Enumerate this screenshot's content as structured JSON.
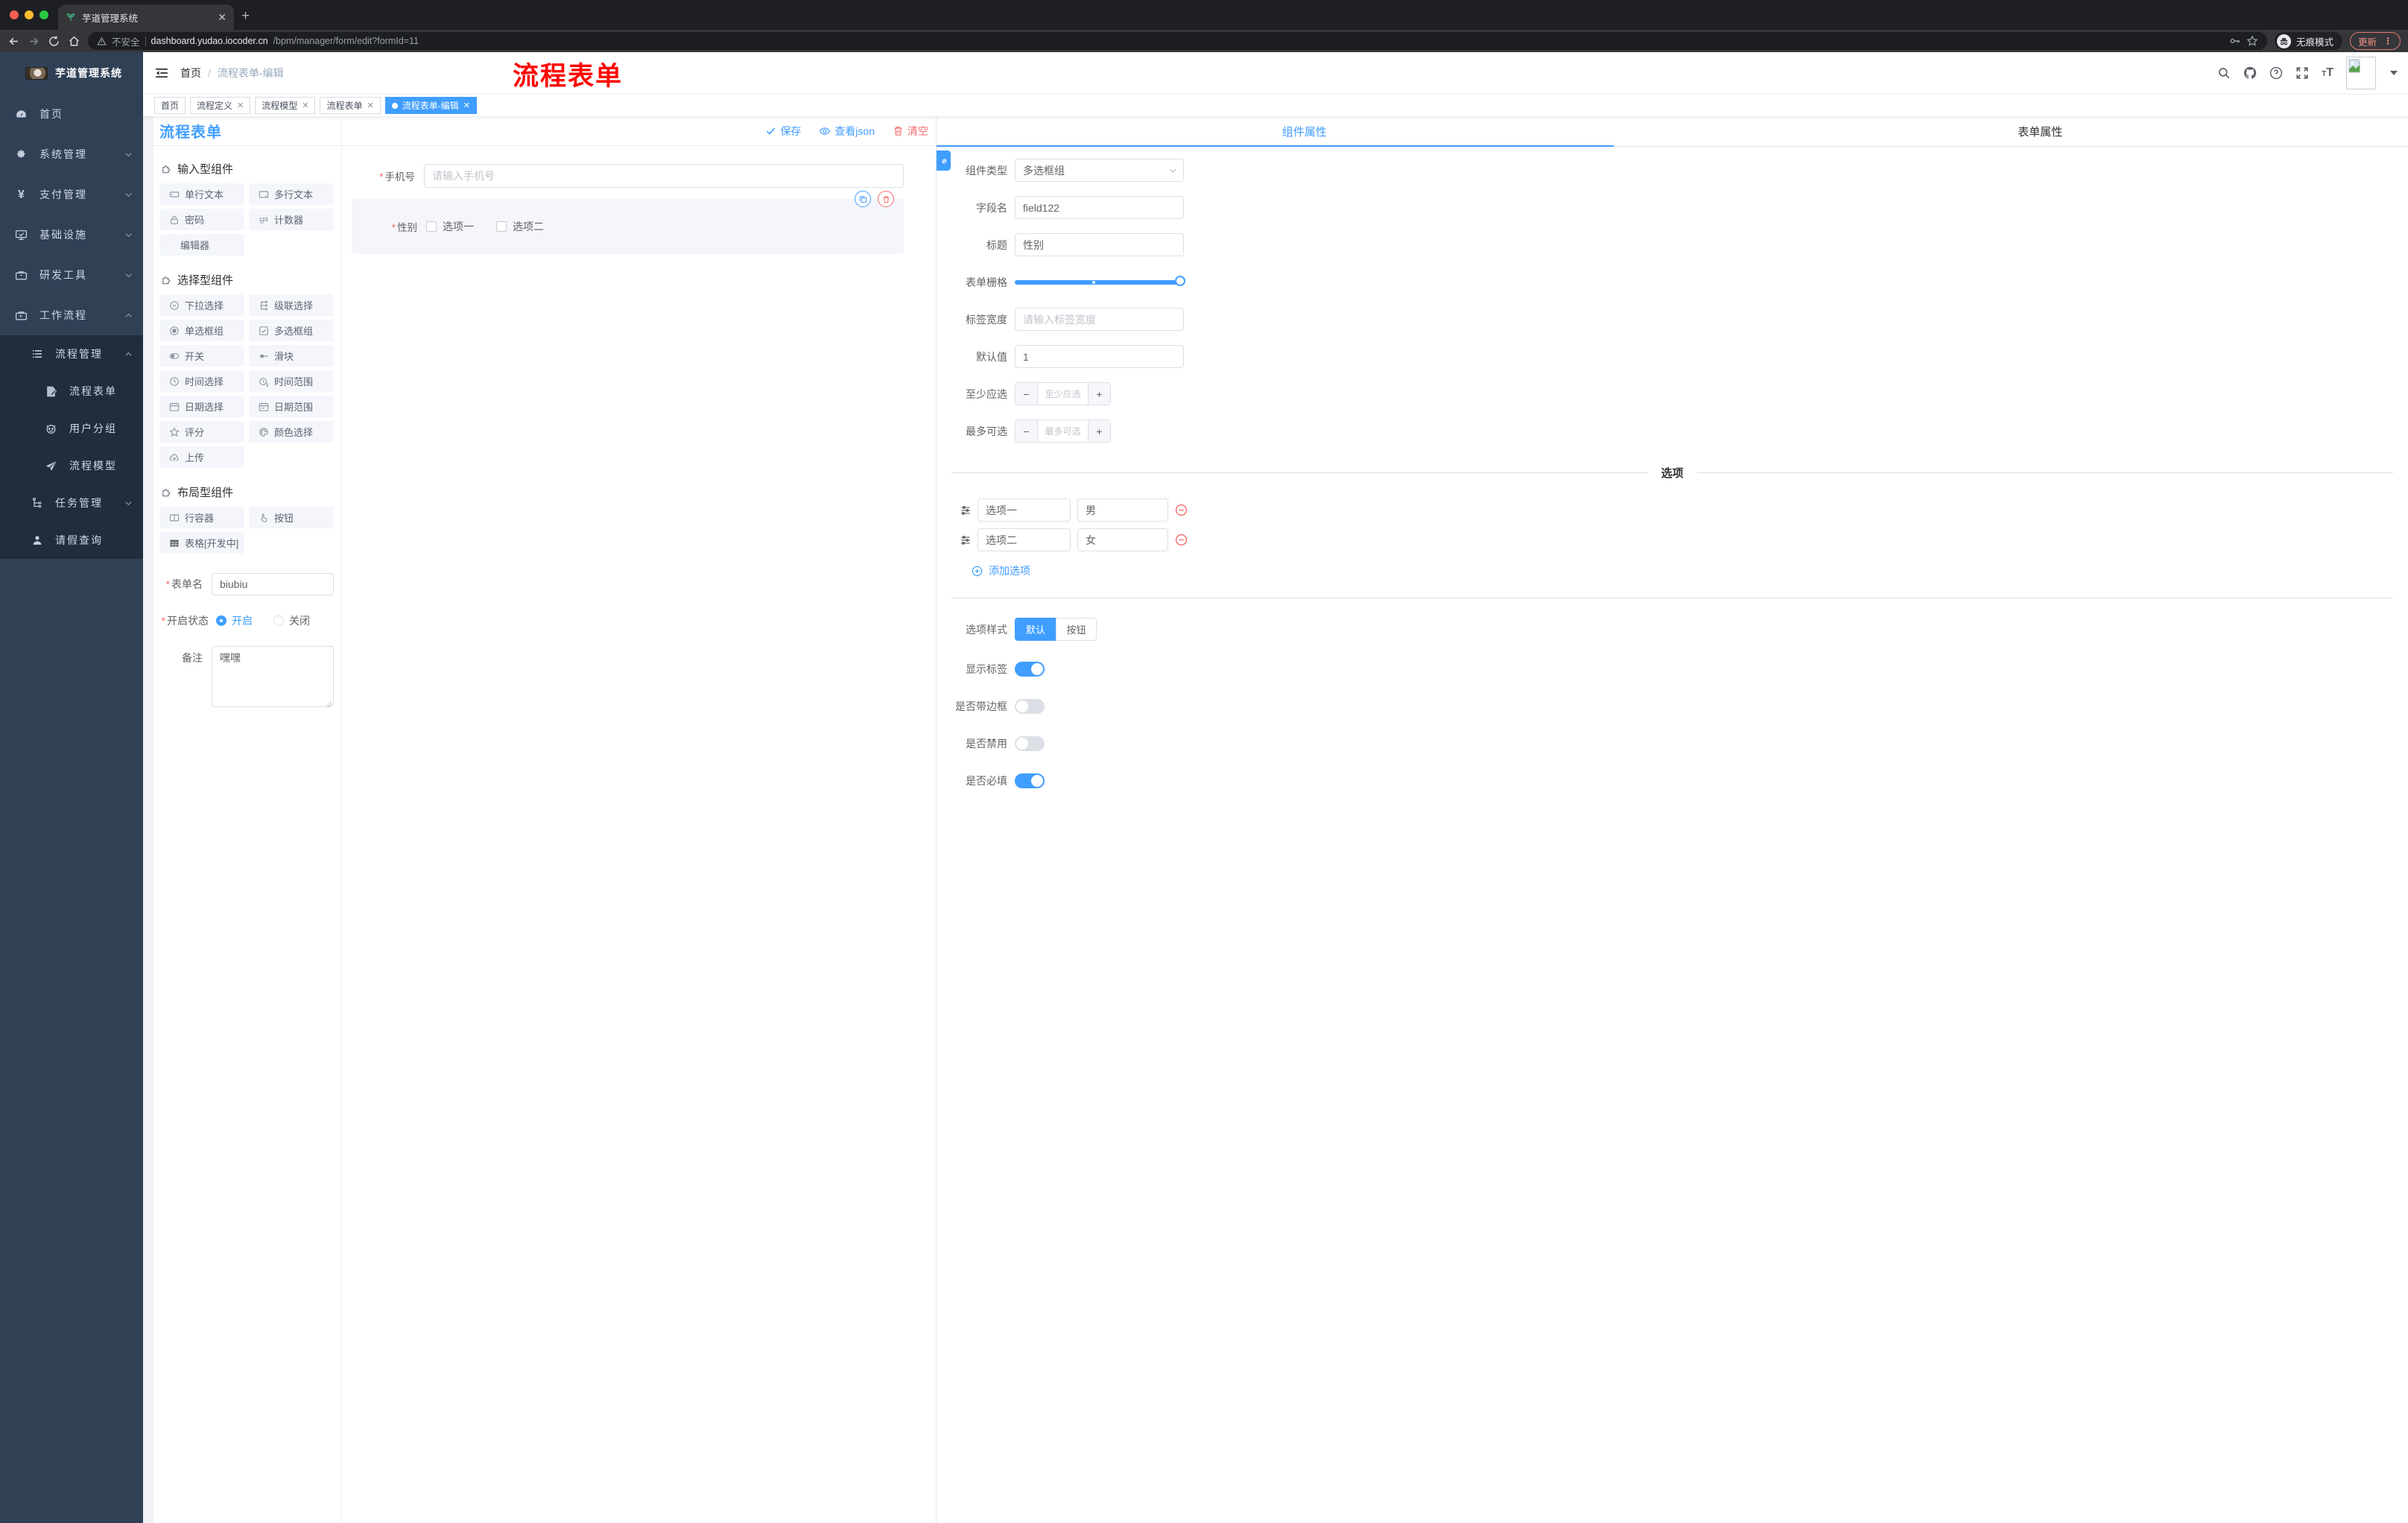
{
  "accent": {
    "primary": "#409eff",
    "danger": "#f56c6c",
    "sidebar_bg": "#304156",
    "submenu_bg": "#1f2d3d",
    "tag_active": "#409eff"
  },
  "browser": {
    "tab_title": "芋道管理系统",
    "security_label": "不安全",
    "url_host": "dashboard.yudao.iocoder.cn",
    "url_path": "/bpm/manager/form/edit?formId=11",
    "incognito_label": "无痕模式",
    "update_label": "更新",
    "menu_dots": "⋮"
  },
  "sidebar": {
    "app_title": "芋道管理系统",
    "items": [
      {
        "label": "首页"
      },
      {
        "label": "系统管理"
      },
      {
        "label": "支付管理"
      },
      {
        "label": "基础设施"
      },
      {
        "label": "研发工具"
      },
      {
        "label": "工作流程"
      }
    ],
    "submenu": [
      {
        "label": "流程管理"
      },
      {
        "label": "流程表单"
      },
      {
        "label": "用户分组"
      },
      {
        "label": "流程模型"
      },
      {
        "label": "任务管理"
      },
      {
        "label": "请假查询"
      }
    ]
  },
  "header": {
    "breadcrumb": {
      "home": "首页",
      "sep": "/",
      "current": "流程表单-编辑"
    },
    "annotation": "流程表单"
  },
  "tags": [
    {
      "label": "首页"
    },
    {
      "label": "流程定义"
    },
    {
      "label": "流程模型"
    },
    {
      "label": "流程表单"
    },
    {
      "label": "流程表单-编辑"
    }
  ],
  "designer": {
    "title": "流程表单",
    "toolbar": {
      "save": "保存",
      "view_json": "查看json",
      "clear": "清空"
    },
    "sections": [
      {
        "title": "输入型组件",
        "items": [
          "单行文本",
          "多行文本",
          "密码",
          "计数器",
          "编辑器"
        ]
      },
      {
        "title": "选择型组件",
        "items": [
          "下拉选择",
          "级联选择",
          "单选框组",
          "多选框组",
          "开关",
          "滑块",
          "时间选择",
          "时间范围",
          "日期选择",
          "日期范围",
          "评分",
          "颜色选择",
          "上传"
        ]
      },
      {
        "title": "布局型组件",
        "items": [
          "行容器",
          "按钮",
          "表格[开发中]"
        ]
      }
    ],
    "form_name": {
      "label": "表单名",
      "value": "biubiu"
    },
    "status": {
      "label": "开启状态",
      "on": "开启",
      "off": "关闭"
    },
    "remark": {
      "label": "备注",
      "value": "嘿嘿"
    }
  },
  "canvas": {
    "phone": {
      "label": "手机号",
      "placeholder": "请输入手机号"
    },
    "gender": {
      "label": "性别",
      "option1": "选项一",
      "option2": "选项二"
    }
  },
  "panel": {
    "tabs": {
      "component": "组件属性",
      "form": "表单属性"
    },
    "component_type": {
      "label": "组件类型",
      "value": "多选框组"
    },
    "field_name": {
      "label": "字段名",
      "value": "field122"
    },
    "title_field": {
      "label": "标题",
      "value": "性别"
    },
    "grid": {
      "label": "表单栅格"
    },
    "label_width": {
      "label": "标签宽度",
      "placeholder": "请输入标签宽度"
    },
    "default_value": {
      "label": "默认值",
      "value": "1"
    },
    "min_select": {
      "label": "至少应选",
      "placeholder": "至少应选"
    },
    "max_select": {
      "label": "最多可选",
      "placeholder": "最多可选"
    },
    "options": {
      "title": "选项",
      "rows": [
        {
          "label": "选项一",
          "value": "男"
        },
        {
          "label": "选项二",
          "value": "女"
        }
      ],
      "add_label": "添加选项"
    },
    "option_style": {
      "label": "选项样式",
      "default": "默认",
      "button": "按钮"
    },
    "switches": [
      {
        "label": "显示标签",
        "on": true
      },
      {
        "label": "是否带边框",
        "on": false
      },
      {
        "label": "是否禁用",
        "on": false
      },
      {
        "label": "是否必填",
        "on": true
      }
    ]
  }
}
